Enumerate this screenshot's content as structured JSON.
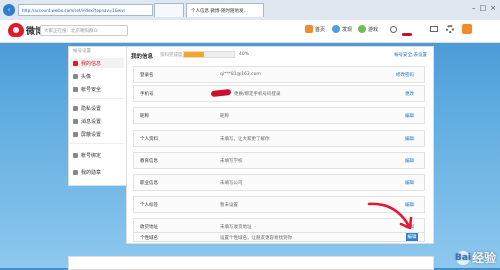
{
  "browser": {
    "url": "http://account.weibo.com/set/index?topnav=1&wvr",
    "tabs": [
      {
        "label": "个人信息 微博-随时随地发..."
      }
    ],
    "window_controls": [
      "–",
      "□",
      "×"
    ]
  },
  "header": {
    "logo_text": "微博",
    "search_placeholder": "大家正在搜：北京朝阳群众",
    "nav": [
      {
        "label": "首页",
        "icon": "home-icon"
      },
      {
        "label": "发现",
        "icon": "discover-icon"
      },
      {
        "label": "游戏",
        "icon": "game-icon"
      }
    ],
    "icons": [
      "user-icon",
      "mail-icon",
      "gear-icon",
      "edit-icon"
    ]
  },
  "sidebar": {
    "title": "帐号设置",
    "items": [
      {
        "label": "我的信息",
        "active": true
      },
      {
        "label": "头像"
      },
      {
        "label": "帐号安全"
      },
      {
        "label": "隐私设置"
      },
      {
        "label": "消息设置"
      },
      {
        "label": "屏蔽设置"
      },
      {
        "label": "帐号绑定"
      },
      {
        "label": "我的勋章"
      }
    ]
  },
  "content": {
    "title": "我的信息",
    "completeness_label": "资料完成度",
    "completeness_pct": 40,
    "completeness_text": "40%",
    "manage_link": "帐号安全,去设置",
    "rows": [
      {
        "label": "登录名",
        "value": "qi***81@163.com",
        "action": "修改密码"
      },
      {
        "label": "手机号",
        "value": "更换/绑定手机号码登录",
        "action": "更改"
      },
      {
        "label": "昵称",
        "value": "昵称",
        "action": "编辑"
      },
      {
        "label": "个人资料",
        "value": "未填写，让大家更了解你",
        "action": "编辑"
      },
      {
        "label": "教育信息",
        "value": "未填写学校",
        "action": "编辑"
      },
      {
        "label": "职业信息",
        "value": "未填写公司",
        "action": "编辑"
      },
      {
        "label": "个人标签",
        "value": "暂未设置",
        "action": "编辑"
      },
      {
        "label": "收货地址",
        "value": "未填写收货地址",
        "action": "编辑"
      },
      {
        "label": "个性域名",
        "value": "设置个性域名，让朋友更容易找到你",
        "action": "编辑"
      }
    ]
  },
  "watermark": {
    "text": "经验",
    "paw": "Bai"
  },
  "colors": {
    "brand": "#e6162d",
    "link": "#1a76c9",
    "progress": "#f6a623"
  }
}
